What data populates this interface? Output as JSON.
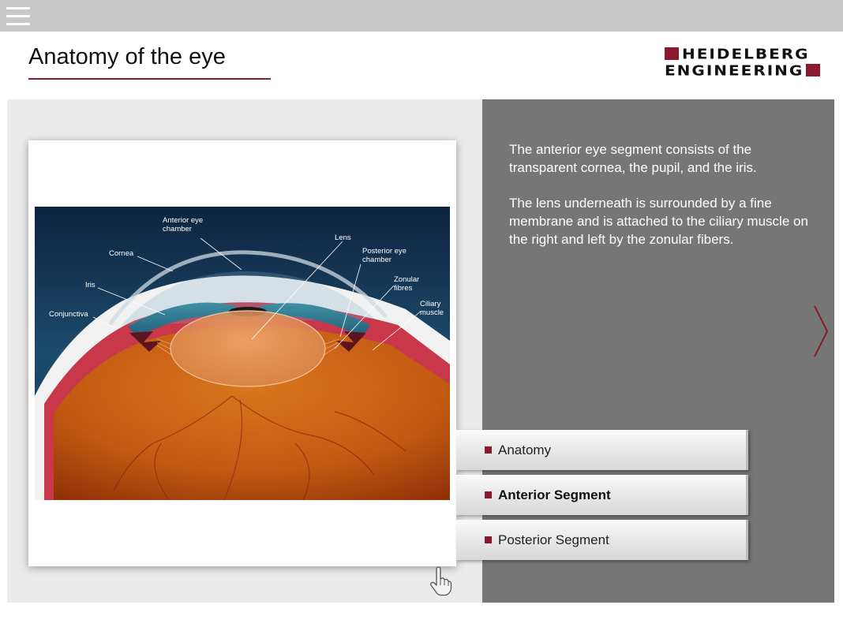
{
  "header": {
    "title": "Anatomy of the eye",
    "logo_line1": "HEIDELBERG",
    "logo_line2": "ENGINEERING"
  },
  "figure": {
    "labels": {
      "anterior_eye_chamber_1": "Anterior eye",
      "anterior_eye_chamber_2": "chamber",
      "cornea": "Cornea",
      "iris": "Iris",
      "conjunctiva": "Conjunctiva",
      "lens": "Lens",
      "posterior_eye_chamber_1": "Posterior eye",
      "posterior_eye_chamber_2": "chamber",
      "zonular_fibres_1": "Zonular",
      "zonular_fibres_2": "fibres",
      "ciliary_muscle_1": "Ciliary",
      "ciliary_muscle_2": "muscle"
    }
  },
  "description": {
    "paragraph1": "The anterior eye segment consists of the transparent cornea, the pupil, and the iris.",
    "paragraph2": "The lens underneath is surrounded by a fine membrane and is attached to the ciliary muscle on the right and left by the zonular fibers."
  },
  "menu": {
    "items": [
      {
        "label": "Anatomy",
        "active": false
      },
      {
        "label": "Anterior Segment",
        "active": true
      },
      {
        "label": "Posterior Segment",
        "active": false
      }
    ]
  },
  "colors": {
    "accent": "#8b1a2e",
    "topbar": "#c8c8c8",
    "right_panel": "#767676",
    "left_panel": "#ebebeb"
  },
  "icons": [
    "hamburger-menu-icon",
    "chevron-right-icon",
    "hand-pointer-icon"
  ]
}
